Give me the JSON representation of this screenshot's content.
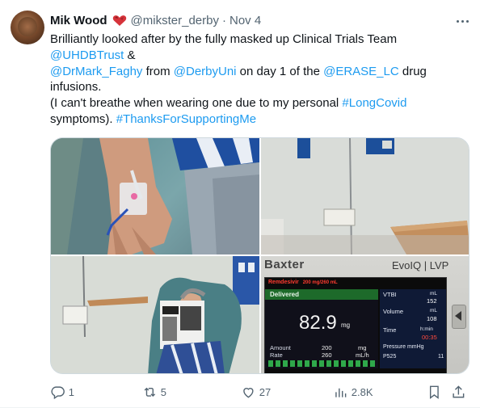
{
  "tweet": {
    "author": {
      "display_name": "Mik Wood",
      "handle": "@mikster_derby",
      "separator": "·",
      "date": "Nov 4"
    },
    "text_lines": [
      [
        {
          "t": "Brilliantly looked after by the fully masked up Clinical Trials Team",
          "link": false
        }
      ],
      [
        {
          "t": "@UHDBTrust",
          "link": true
        },
        {
          "t": " &",
          "link": false
        }
      ],
      [
        {
          "t": "@DrMark_Faghy",
          "link": true
        },
        {
          "t": " from ",
          "link": false
        },
        {
          "t": "@DerbyUni",
          "link": true
        },
        {
          "t": " on day 1 of the ",
          "link": false
        },
        {
          "t": "@ERASE_LC",
          "link": true
        },
        {
          "t": " drug",
          "link": false
        }
      ],
      [
        {
          "t": "infusions.",
          "link": false
        }
      ],
      [
        {
          "t": "(I can't breathe when wearing one due to my personal ",
          "link": false
        },
        {
          "t": "#LongCovid",
          "link": true
        }
      ],
      [
        {
          "t": "symptoms). ",
          "link": false
        },
        {
          "t": "#ThanksForSupportingMe",
          "link": true
        }
      ]
    ],
    "pump": {
      "brand": "Baxter",
      "model": "EvoIQ | LVP",
      "drug": "Remdesivir",
      "drug_conc": "200 mg/260 mL",
      "status": "Delivered",
      "amount_value": "82.9",
      "amount_unit": "mg",
      "amount_label": "Amount",
      "rate_label": "Rate",
      "amount_row": "200",
      "amount_row_unit": "mg",
      "rate_row": "260",
      "rate_row_unit": "mL/h",
      "vtbi_label": "VTBI",
      "vtbi_unit": "mL",
      "vtbi_value": "152",
      "volume_label": "Volume",
      "volume_unit": "mL",
      "volume_value": "108",
      "time_label": "Time",
      "time_unit": "h:min",
      "time_value": "00:35",
      "pressure_label": "Pressure mmHg",
      "pressure_code": "P525",
      "pressure_value": "11"
    },
    "actions": {
      "replies": "1",
      "reposts": "5",
      "likes": "27",
      "views": "2.8K"
    },
    "colors": {
      "link": "#1d9bf0",
      "secondary_text": "#536471",
      "accent_red": "#e3342f"
    },
    "icons": [
      "heart-badge-icon",
      "more-icon",
      "reply-icon",
      "repost-icon",
      "like-icon",
      "views-icon",
      "bookmark-icon",
      "share-icon"
    ]
  }
}
